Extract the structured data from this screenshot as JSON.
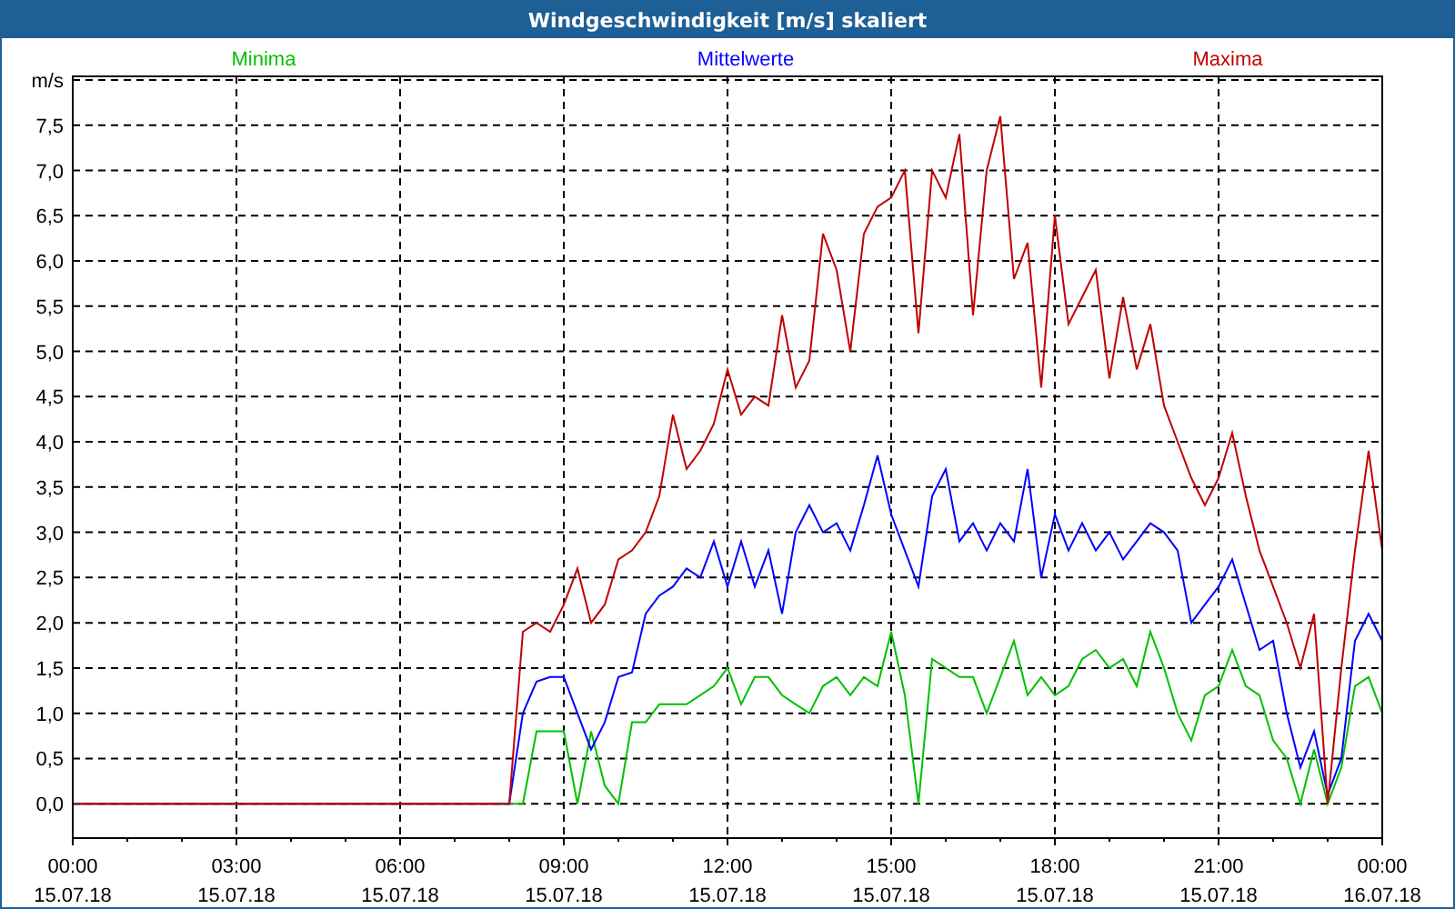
{
  "window": {
    "title": "Windgeschwindigkeit [m/s] skaliert"
  },
  "chart": {
    "x_axis_dates": [
      "15.07.18",
      "15.07.18",
      "15.07.18",
      "15.07.18",
      "15.07.18",
      "15.07.18",
      "15.07.18",
      "15.07.18",
      "16.07.18"
    ],
    "chart_data": {
      "type": "line",
      "ylim": [
        -0.38,
        8.04
      ],
      "xlim": [
        0,
        24
      ],
      "yticks": [
        {
          "value": 0,
          "label": "0,0"
        },
        {
          "value": 0.5,
          "label": "0,5"
        },
        {
          "value": 1,
          "label": "1,0"
        },
        {
          "value": 1.5,
          "label": "1,5"
        },
        {
          "value": 2,
          "label": "2,0"
        },
        {
          "value": 2.5,
          "label": "2,5"
        },
        {
          "value": 3,
          "label": "3,0"
        },
        {
          "value": 3.5,
          "label": "3,5"
        },
        {
          "value": 4,
          "label": "4,0"
        },
        {
          "value": 4.5,
          "label": "4,5"
        },
        {
          "value": 5,
          "label": "5,0"
        },
        {
          "value": 5.5,
          "label": "5,5"
        },
        {
          "value": 6,
          "label": "6,0"
        },
        {
          "value": 6.5,
          "label": "6,5"
        },
        {
          "value": 7,
          "label": "7,0"
        },
        {
          "value": 7.5,
          "label": "7,5"
        },
        {
          "value": 8,
          "label": "m/s"
        }
      ],
      "xticks": [
        {
          "value": 0,
          "label": "00:00"
        },
        {
          "value": 3,
          "label": "03:00"
        },
        {
          "value": 6,
          "label": "06:00"
        },
        {
          "value": 9,
          "label": "09:00"
        },
        {
          "value": 12,
          "label": "12:00"
        },
        {
          "value": 15,
          "label": "15:00"
        },
        {
          "value": 18,
          "label": "18:00"
        },
        {
          "value": 21,
          "label": "21:00"
        },
        {
          "value": 24,
          "label": "00:00"
        }
      ],
      "grid": true,
      "x": [
        0,
        8,
        8.25,
        8.5,
        8.75,
        9,
        9.25,
        9.5,
        9.75,
        10,
        10.25,
        10.5,
        10.75,
        11,
        11.25,
        11.5,
        11.75,
        12,
        12.25,
        12.5,
        12.75,
        13,
        13.25,
        13.5,
        13.75,
        14,
        14.25,
        14.5,
        14.75,
        15,
        15.25,
        15.5,
        15.75,
        16,
        16.25,
        16.5,
        16.75,
        17,
        17.25,
        17.5,
        17.75,
        18,
        18.25,
        18.5,
        18.75,
        19,
        19.25,
        19.5,
        19.75,
        20,
        20.25,
        20.5,
        20.75,
        21,
        21.25,
        21.5,
        21.75,
        22,
        22.25,
        22.5,
        22.75,
        23,
        23.25,
        23.5,
        23.75,
        24
      ],
      "series": [
        {
          "name": "Minima",
          "color": "#00c000",
          "values": [
            0,
            0,
            0,
            0.8,
            0.8,
            0.8,
            0.0,
            0.8,
            0.2,
            0.0,
            0.9,
            0.9,
            1.1,
            1.1,
            1.1,
            1.2,
            1.3,
            1.5,
            1.1,
            1.4,
            1.4,
            1.2,
            1.1,
            1.0,
            1.3,
            1.4,
            1.2,
            1.4,
            1.3,
            1.9,
            1.2,
            0.0,
            1.6,
            1.5,
            1.4,
            1.4,
            1.0,
            1.4,
            1.8,
            1.2,
            1.4,
            1.2,
            1.3,
            1.6,
            1.7,
            1.5,
            1.6,
            1.3,
            1.9,
            1.5,
            1.0,
            0.7,
            1.2,
            1.3,
            1.7,
            1.3,
            1.2,
            0.7,
            0.5,
            0.0,
            0.6,
            0.0,
            0.4,
            1.3,
            1.4,
            1.0
          ]
        },
        {
          "name": "Mittelwerte",
          "color": "#0000ff",
          "values": [
            0,
            0,
            1.0,
            1.35,
            1.4,
            1.4,
            1.0,
            0.6,
            0.9,
            1.4,
            1.45,
            2.1,
            2.3,
            2.4,
            2.6,
            2.5,
            2.9,
            2.4,
            2.9,
            2.4,
            2.8,
            2.1,
            3.0,
            3.3,
            3.0,
            3.1,
            2.8,
            3.3,
            3.85,
            3.2,
            2.8,
            2.4,
            3.4,
            3.7,
            2.9,
            3.1,
            2.8,
            3.1,
            2.9,
            3.7,
            2.5,
            3.2,
            2.8,
            3.1,
            2.8,
            3.0,
            2.7,
            2.9,
            3.1,
            3.0,
            2.8,
            2.0,
            2.2,
            2.4,
            2.7,
            2.2,
            1.7,
            1.8,
            1.0,
            0.4,
            0.8,
            0.1,
            0.5,
            1.8,
            2.1,
            1.8
          ]
        },
        {
          "name": "Maxima",
          "color": "#c00000",
          "values": [
            0,
            0,
            1.9,
            2.0,
            1.9,
            2.2,
            2.6,
            2.0,
            2.2,
            2.7,
            2.8,
            3.0,
            3.4,
            4.3,
            3.7,
            3.9,
            4.2,
            4.8,
            4.3,
            4.5,
            4.4,
            5.4,
            4.6,
            4.9,
            6.3,
            5.9,
            5.0,
            6.3,
            6.6,
            6.7,
            7.0,
            5.2,
            7.0,
            6.7,
            7.4,
            5.4,
            7.0,
            7.6,
            5.8,
            6.2,
            4.6,
            6.5,
            5.3,
            5.6,
            5.9,
            4.7,
            5.6,
            4.8,
            5.3,
            4.4,
            4.0,
            3.6,
            3.3,
            3.6,
            4.1,
            3.4,
            2.8,
            2.4,
            2.0,
            1.5,
            2.1,
            0.0,
            1.5,
            2.8,
            3.9,
            2.8
          ]
        }
      ]
    }
  }
}
